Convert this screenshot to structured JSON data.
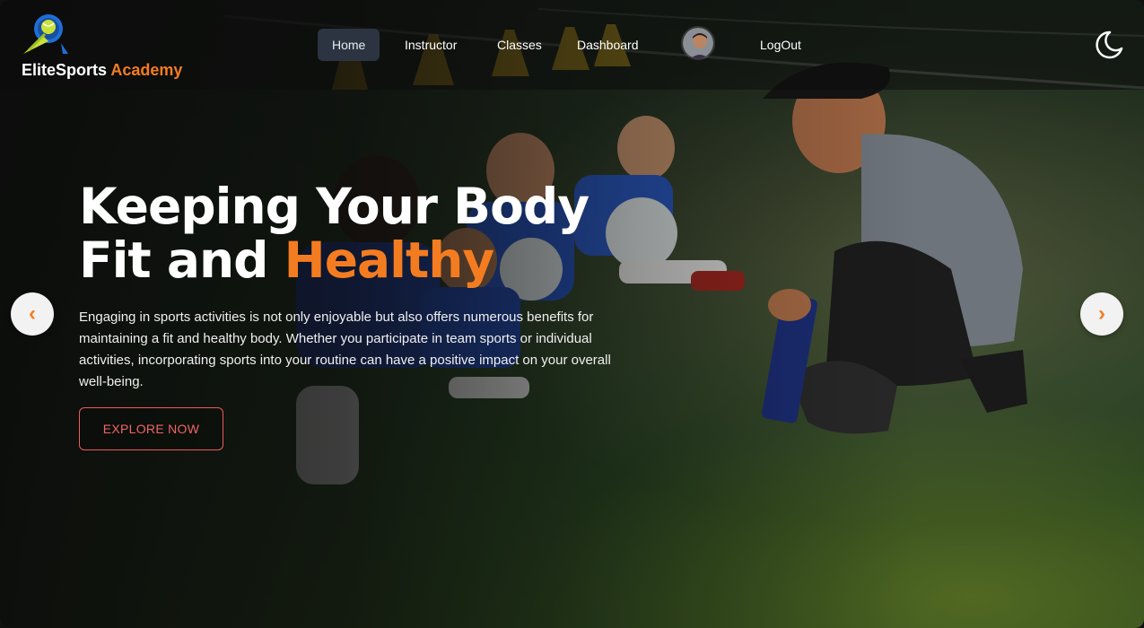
{
  "brand": {
    "name_part1": "EliteSports",
    "name_part2": "Academy",
    "logo_icon": "tennis-ball-logo-icon"
  },
  "nav": {
    "items": [
      {
        "label": "Home",
        "active": true
      },
      {
        "label": "Instructor",
        "active": false
      },
      {
        "label": "Classes",
        "active": false
      },
      {
        "label": "Dashboard",
        "active": false
      },
      {
        "label": "LogOut",
        "active": false
      }
    ],
    "avatar_icon": "user-avatar",
    "theme_toggle_icon": "moon-icon"
  },
  "hero": {
    "title_line1": "Keeping Your Body",
    "title_line2_prefix": "Fit and",
    "title_line2_accent": "Healthy",
    "description": "Engaging in sports activities is not only enjoyable but also offers numerous benefits for maintaining a fit and healthy body. Whether you participate in team sports or individual activities, incorporating sports into your routine can have a positive impact on your overall well-being.",
    "cta_label": "Explore Now"
  },
  "carousel": {
    "prev_label": "‹",
    "next_label": "›"
  },
  "colors": {
    "accent": "#f47c20",
    "cta_border": "#f05a5a",
    "nav_active_bg": "#2b3440"
  }
}
